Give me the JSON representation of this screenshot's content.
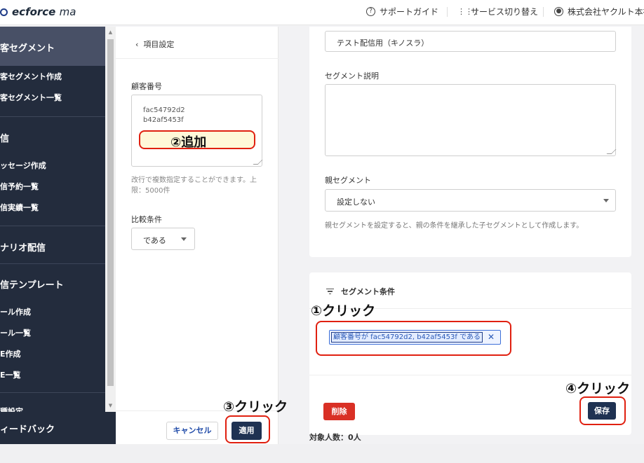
{
  "header": {
    "logo_text": "ecforce",
    "logo_suffix": "ma",
    "support_guide": "サポートガイド",
    "service_switch": "サービス切り替え",
    "company": "株式会社ヤクルト本社",
    "icons": {
      "support": "help-circle-icon",
      "switch": "grid-icon",
      "account": "user-circle-icon"
    }
  },
  "sidebar": {
    "head": "客セグメント",
    "items_segment": [
      "客セグメント作成",
      "客セグメント一覧"
    ],
    "section_delivery": "信",
    "items_delivery": [
      "ッセージ作成",
      "信予約一覧",
      "信実績一覧"
    ],
    "section_scenario": "ナリオ配信",
    "section_template": "信テンプレート",
    "items_template": [
      "ール作成",
      "ール一覧",
      "E作成",
      "E一覧"
    ],
    "section_settings": "種設定",
    "footer": "ィードバック"
  },
  "filter_panel": {
    "back_label": "項目設定",
    "customer_number_label": "顧客番号",
    "textarea_lines": [
      "fac54792d2",
      "b42af5453f"
    ],
    "hint": "改行で複数指定することができます。上限：5000件",
    "compare_label": "比較条件",
    "compare_value": "である",
    "cancel_label": "キャンセル",
    "apply_label": "適用"
  },
  "segment_form": {
    "name_value": "テスト配信用（キノスラ）",
    "description_label": "セグメント説明",
    "parent_label": "親セグメント",
    "parent_value": "設定しない",
    "parent_hint": "親セグメントを設定すると、親の条件を継承した子セグメントとして作成します。"
  },
  "conditions": {
    "title": "セグメント条件",
    "chip_text": "顧客番号が fac54792d2, b42af5453f である",
    "chip_close": "✕",
    "delete_label": "削除",
    "save_label": "保存",
    "count_text": "対象人数：0人"
  },
  "annotations": {
    "step1": "①クリック",
    "step2": "②追加",
    "step3": "③クリック",
    "step4": "④クリック",
    "highlight_color": "#e02010"
  },
  "colors": {
    "sidebar_bg": "#232c3d",
    "primary_button": "#1f3252",
    "danger_button": "#d93025",
    "link": "#1f4aa8"
  }
}
